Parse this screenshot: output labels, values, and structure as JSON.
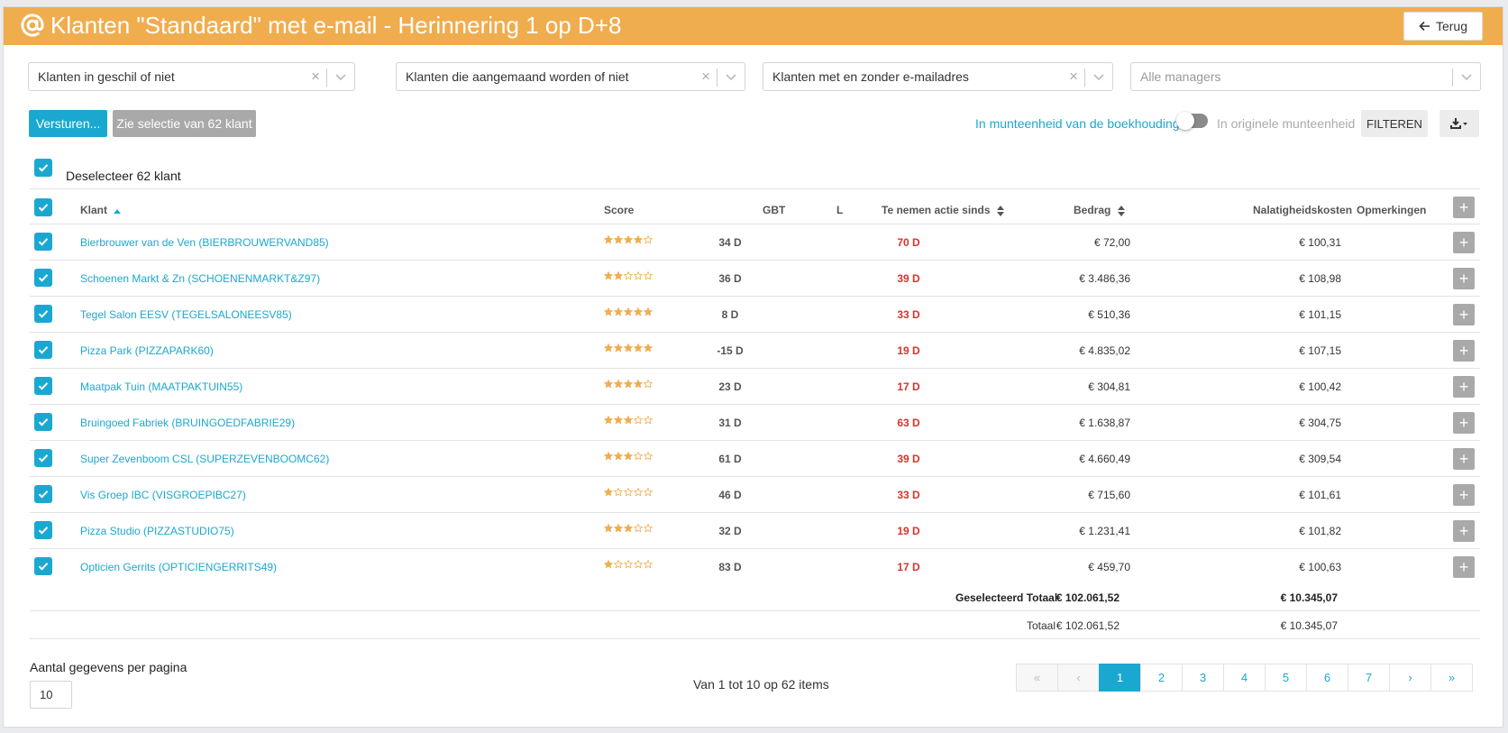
{
  "header": {
    "title": "Klanten \"Standaard\" met e-mail - Herinnering 1 op D+8",
    "back_label": "Terug"
  },
  "filters": [
    {
      "value": "Klanten in geschil of niet",
      "placeholder": false
    },
    {
      "value": "Klanten die aangemaand worden of niet",
      "placeholder": false
    },
    {
      "value": "Klanten met en zonder e-mailadres",
      "placeholder": false
    },
    {
      "value": "Alle managers",
      "placeholder": true
    }
  ],
  "actions": {
    "send_label": "Versturen...",
    "selection_label": "Zie selectie van 62 klant",
    "currency_accounting": "In munteenheid van de boekhouding",
    "currency_original": "In originele munteenheid",
    "currency_toggle_on": false,
    "filter_label": "FILTEREN"
  },
  "deselect_label": "Deselecteer 62 klant",
  "columns": {
    "klant": "Klant",
    "score": "Score",
    "gbt": "GBT",
    "l": "L",
    "actie": "Te nemen actie sinds",
    "bedrag": "Bedrag",
    "nalatigheid": "Nalatigheidskosten",
    "opmerkingen": "Opmerkingen"
  },
  "rows": [
    {
      "klant": "Bierbrouwer van de Ven (BIERBROUWERVAND85)",
      "score": 4,
      "gbt": "34 D",
      "actie": "70 D",
      "bedrag": "€ 72,00",
      "nalatigheid": "€ 100,31"
    },
    {
      "klant": "Schoenen Markt & Zn (SCHOENENMARKT&Z97)",
      "score": 2,
      "gbt": "36 D",
      "actie": "39 D",
      "bedrag": "€ 3.486,36",
      "nalatigheid": "€ 108,98"
    },
    {
      "klant": "Tegel Salon EESV (TEGELSALONEESV85)",
      "score": 5,
      "gbt": "8 D",
      "actie": "33 D",
      "bedrag": "€ 510,36",
      "nalatigheid": "€ 101,15"
    },
    {
      "klant": "Pizza Park (PIZZAPARK60)",
      "score": 5,
      "gbt": "-15 D",
      "actie": "19 D",
      "bedrag": "€ 4.835,02",
      "nalatigheid": "€ 107,15"
    },
    {
      "klant": "Maatpak Tuin (MAATPAKTUIN55)",
      "score": 4,
      "gbt": "23 D",
      "actie": "17 D",
      "bedrag": "€ 304,81",
      "nalatigheid": "€ 100,42"
    },
    {
      "klant": "Bruingoed Fabriek (BRUINGOEDFABRIE29)",
      "score": 3,
      "gbt": "31 D",
      "actie": "63 D",
      "bedrag": "€ 1.638,87",
      "nalatigheid": "€ 304,75"
    },
    {
      "klant": "Super Zevenboom CSL (SUPERZEVENBOOMC62)",
      "score": 3,
      "gbt": "61 D",
      "actie": "39 D",
      "bedrag": "€ 4.660,49",
      "nalatigheid": "€ 309,54"
    },
    {
      "klant": "Vis Groep IBC (VISGROEPIBC27)",
      "score": 1,
      "gbt": "46 D",
      "actie": "33 D",
      "bedrag": "€ 715,60",
      "nalatigheid": "€ 101,61"
    },
    {
      "klant": "Pizza Studio (PIZZASTUDIO75)",
      "score": 3,
      "gbt": "32 D",
      "actie": "19 D",
      "bedrag": "€ 1.231,41",
      "nalatigheid": "€ 101,82"
    },
    {
      "klant": "Opticien Gerrits (OPTICIENGERRITS49)",
      "score": 1,
      "gbt": "83 D",
      "actie": "17 D",
      "bedrag": "€ 459,70",
      "nalatigheid": "€ 100,63"
    }
  ],
  "totals": {
    "selected_label": "Geselecteerd Totaal",
    "selected_bedrag": "€ 102.061,52",
    "selected_nalatigheid": "€ 10.345,07",
    "total_label": "Totaal",
    "total_bedrag": "€ 102.061,52",
    "total_nalatigheid": "€ 10.345,07"
  },
  "pagination": {
    "per_page_label": "Aantal gegevens per pagina",
    "per_page_value": "10",
    "info": "Van 1 tot 10 op 62 items",
    "first": "«",
    "prev": "‹",
    "pages": [
      "1",
      "2",
      "3",
      "4",
      "5",
      "6",
      "7"
    ],
    "current": "1",
    "next": "›",
    "last": "»"
  },
  "colors": {
    "header": "#f0ad4e",
    "primary": "#1ba8d0",
    "danger": "#d9342b",
    "star": "#f0ad4e"
  }
}
